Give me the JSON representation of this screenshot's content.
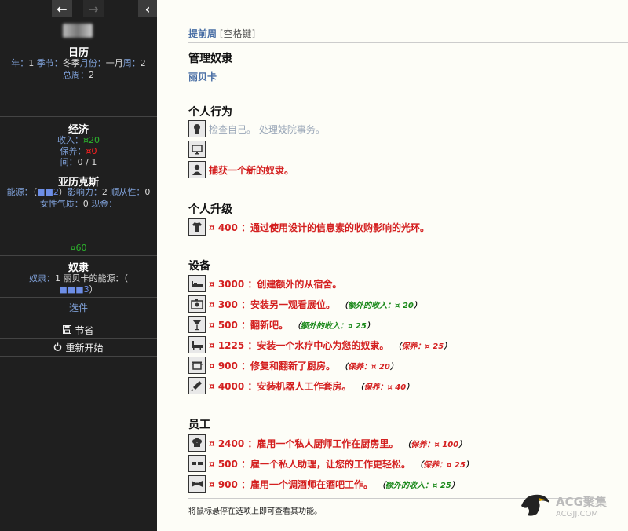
{
  "sidebar": {
    "calendar": {
      "title": "日历",
      "year_label": "年：",
      "year_value": "1",
      "season_label": "季节：",
      "season_value": "冬季",
      "month_label": "月份：",
      "month_value": "一月",
      "week_label": "周：",
      "week_value": "2",
      "total_week_label": "总周：",
      "total_week_value": "2"
    },
    "economy": {
      "title": "经济",
      "income_label": "收入：",
      "income_value": "¤20",
      "upkeep_label": "保养：",
      "upkeep_value": "¤0",
      "room_label": "间：",
      "room_value": "0 / 1"
    },
    "player": {
      "title": "亚历克斯",
      "energy_label": "能源：",
      "energy_value": "■■2",
      "influence_label": "影响力：",
      "influence_value": "2",
      "obedience_label": "顺从性：",
      "obedience_value": "0",
      "feminine_label": "女性气质：",
      "feminine_value": "0",
      "cash_label": "现金：",
      "cash_value": "¤60"
    },
    "slaves": {
      "title": "奴隶",
      "line1_label": "奴隶：",
      "line1_value": "1",
      "line1_rest": "丽贝卡的能源：",
      "energy_value": "■■■3"
    },
    "options_link": "选件",
    "save_button": "节省",
    "restart_button": "重新开始"
  },
  "main": {
    "header_link": "提前周",
    "header_key": "[空格键]",
    "manage_title": "管理奴隶",
    "slave_name": "丽贝卡",
    "personal_actions_title": "个人行为",
    "personal_actions": [
      {
        "icon": "user-head-icon",
        "text": "检查自己。 处理妓院事务。",
        "style": "grey"
      },
      {
        "icon": "monitor-icon",
        "text": "",
        "style": "grey"
      },
      {
        "icon": "capture-person-icon",
        "text": "捕获一个新的奴隶。",
        "style": "red"
      }
    ],
    "upgrades_title": "个人升级",
    "upgrades": [
      {
        "icon": "shirt-icon",
        "text": "¤ 400 ：通过使用设计的信息素的收购影响的光环。"
      }
    ],
    "equipment_title": "设备",
    "equipment": [
      {
        "icon": "bed-icon",
        "text": "¤ 3000 ：创建额外的从宿舍。",
        "note_label": "",
        "note_value": "",
        "note_type": ""
      },
      {
        "icon": "camera-icon",
        "text": "¤ 300 ：安装另一观看展位。",
        "note_label": "额外的收入：",
        "note_value": "¤ 20",
        "note_type": "income"
      },
      {
        "icon": "cocktail-icon",
        "text": "¤ 500 ：翻新吧。",
        "note_label": "额外的收入：",
        "note_value": "¤ 25",
        "note_type": "income"
      },
      {
        "icon": "bathtub-icon",
        "text": "¤ 1225 ：安装一个水疗中心为您的奴隶。",
        "note_label": "保养：",
        "note_value": "¤ 25",
        "note_type": "upkeep"
      },
      {
        "icon": "pot-icon",
        "text": "¤ 900 ：修复和翻新了厨房。",
        "note_label": "保养：",
        "note_value": "¤ 20",
        "note_type": "upkeep"
      },
      {
        "icon": "syringe-icon",
        "text": "¤ 4000 ：安装机器人工作套房。",
        "note_label": "保养：",
        "note_value": "¤ 40",
        "note_type": "upkeep"
      }
    ],
    "staff_title": "员工",
    "staff": [
      {
        "icon": "chef-hat-icon",
        "text": "¤ 2400 ：雇用一个私人厨师工作在厨房里。",
        "note_label": "保养：",
        "note_value": "¤ 100",
        "note_type": "upkeep"
      },
      {
        "icon": "glasses-icon",
        "text": "¤ 500 ：雇一个私人助理，让您的工作更轻松。",
        "note_label": "保养：",
        "note_value": "¤ 25",
        "note_type": "upkeep"
      },
      {
        "icon": "bowtie-icon",
        "text": "¤ 900 ：雇用一个调酒师在酒吧工作。",
        "note_label": "额外的收入：",
        "note_value": "¤ 25",
        "note_type": "income"
      }
    ],
    "footer_hint": "将鼠标悬停在选项上即可查看其功能。"
  },
  "watermark": {
    "title": "ACG聚集",
    "url": "ACGJJ.COM"
  }
}
